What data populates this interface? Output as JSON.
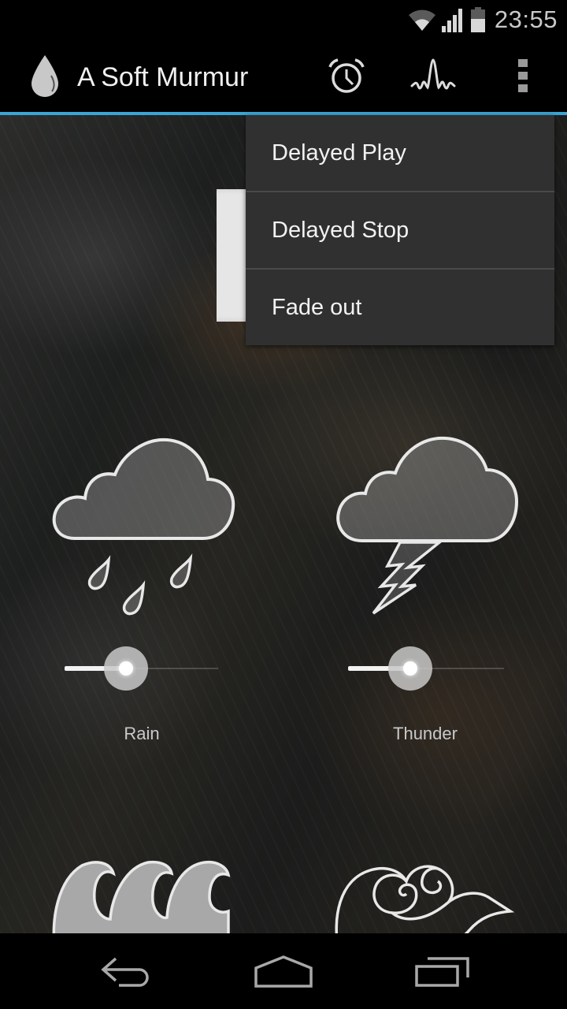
{
  "status_bar": {
    "time": "23:55",
    "icons": [
      "wifi-icon",
      "cell-signal-icon",
      "battery-icon"
    ]
  },
  "action_bar": {
    "app_icon": "water-drop-icon",
    "title": "A Soft Murmur",
    "actions": [
      {
        "name": "timer",
        "icon": "alarm-clock-icon"
      },
      {
        "name": "sound-mix",
        "icon": "waveform-icon"
      },
      {
        "name": "overflow",
        "icon": "more-vert-icon"
      }
    ],
    "accent_color": "#3aa6d6"
  },
  "overflow_menu": {
    "items": [
      {
        "label": "Delayed Play"
      },
      {
        "label": "Delayed Stop"
      },
      {
        "label": "Fade out"
      }
    ]
  },
  "sounds": [
    {
      "label": "Rain",
      "icon": "rain-cloud-icon",
      "volume": 0.4
    },
    {
      "label": "Thunder",
      "icon": "thunder-cloud-icon",
      "volume": 0.4
    },
    {
      "label": "",
      "icon": "waves-icon"
    },
    {
      "label": "",
      "icon": "wind-cloud-icon"
    }
  ],
  "nav_bar": {
    "buttons": [
      "back",
      "home",
      "recent-apps"
    ]
  }
}
